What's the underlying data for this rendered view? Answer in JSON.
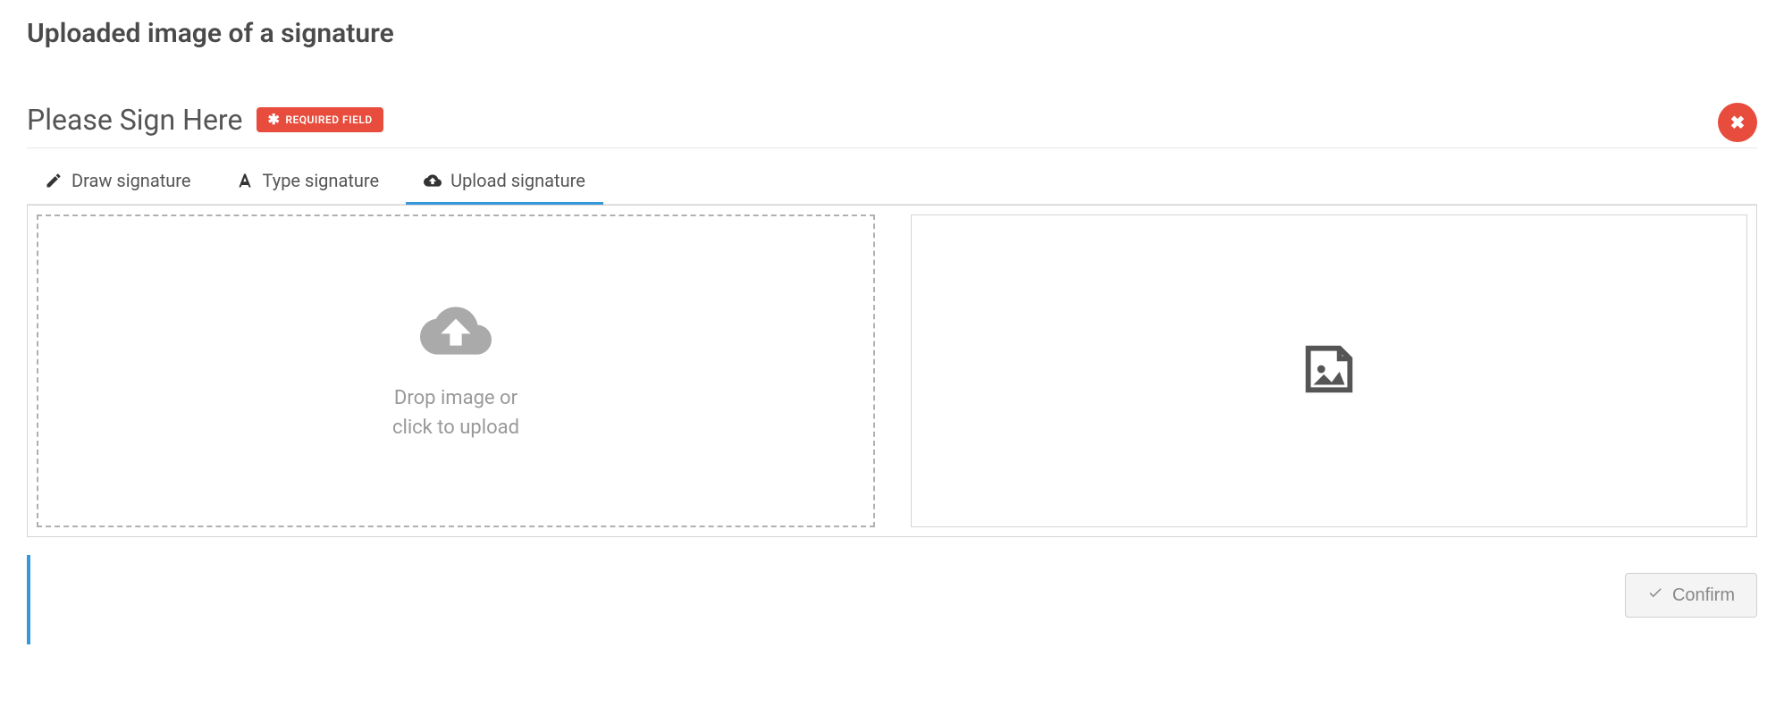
{
  "page": {
    "title": "Uploaded image of a signature"
  },
  "widget": {
    "title": "Please Sign Here",
    "required_badge": "REQUIRED FIELD",
    "close_icon": "close"
  },
  "tabs": {
    "draw": "Draw signature",
    "type": "Type signature",
    "upload": "Upload signature",
    "active": "upload"
  },
  "dropzone": {
    "line1": "Drop image or",
    "line2": "click to upload"
  },
  "footer": {
    "confirm_label": "Confirm"
  }
}
